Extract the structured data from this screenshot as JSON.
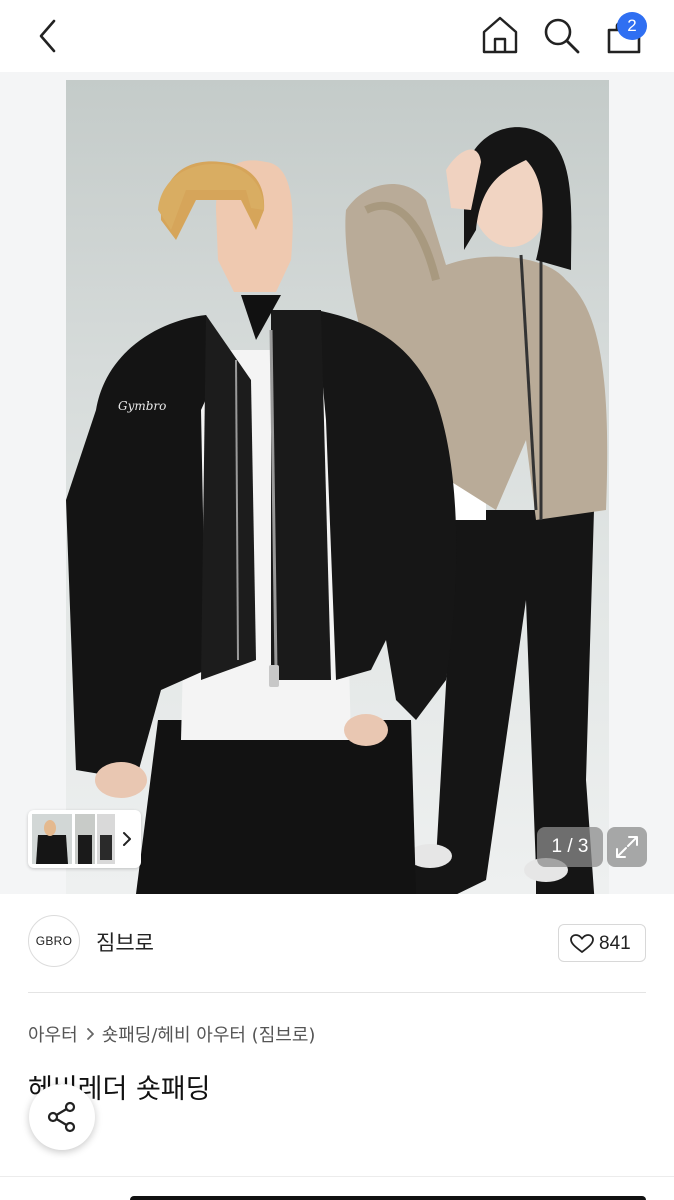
{
  "header": {
    "back_icon": "chevron-left-icon",
    "home_icon": "home-icon",
    "search_icon": "search-icon",
    "cart_icon": "shopping-bag-icon",
    "cart_count": "2"
  },
  "gallery": {
    "counter": "1 / 3",
    "expand_icon": "expand-icon",
    "thumb_arrow_icon": "chevron-right-icon",
    "jacket_text": "Gymbro"
  },
  "seller": {
    "logo_text": "GBRO",
    "name": "짐브로",
    "like_icon": "heart-icon",
    "like_count": "841"
  },
  "product": {
    "breadcrumb": [
      "아우터",
      "숏패딩/헤비 아우터 (짐브로)"
    ],
    "title_visible_fragment": "헤비레더 숏패딩"
  },
  "actions": {
    "share_icon": "share-icon"
  },
  "colors": {
    "accent": "#2f6ff2",
    "text": "#111111",
    "muted": "#555555"
  }
}
